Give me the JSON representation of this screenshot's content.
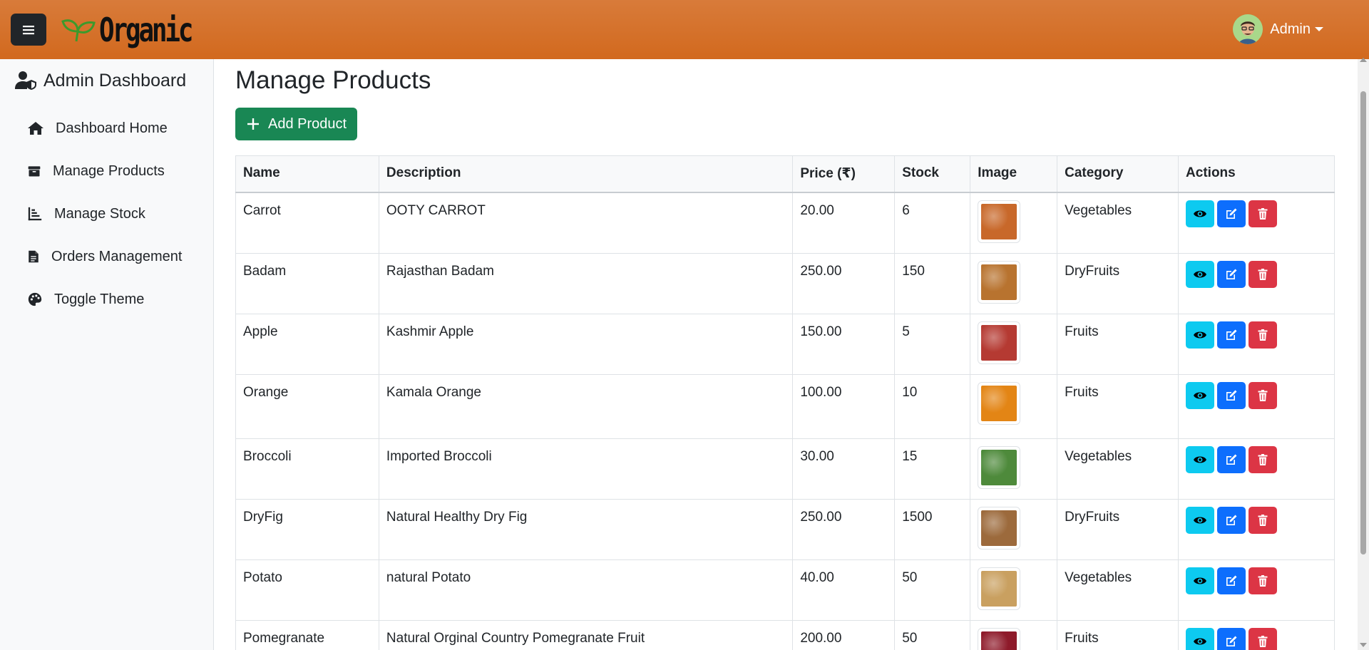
{
  "brand": {
    "name": "Organic"
  },
  "user": {
    "name": "Admin"
  },
  "sidebar": {
    "title": "Admin Dashboard",
    "items": [
      {
        "label": "Dashboard Home",
        "icon": "home-icon"
      },
      {
        "label": "Manage Products",
        "icon": "box-icon"
      },
      {
        "label": "Manage Stock",
        "icon": "bar-chart-icon"
      },
      {
        "label": "Orders Management",
        "icon": "document-icon"
      },
      {
        "label": "Toggle Theme",
        "icon": "palette-icon"
      }
    ]
  },
  "main": {
    "title": "Manage Products",
    "add_button": "Add Product"
  },
  "table": {
    "headers": [
      "Name",
      "Description",
      "Price (₹)",
      "Stock",
      "Image",
      "Category",
      "Actions"
    ],
    "rows": [
      {
        "name": "Carrot",
        "description": "OOTY CARROT",
        "price": "20.00",
        "stock": "6",
        "category": "Vegetables",
        "image": "carrot-image",
        "color": "#c8682a"
      },
      {
        "name": "Badam",
        "description": "Rajasthan Badam",
        "price": "250.00",
        "stock": "150",
        "category": "DryFruits",
        "image": "almond-image",
        "color": "#b8732f"
      },
      {
        "name": "Apple",
        "description": "Kashmir Apple",
        "price": "150.00",
        "stock": "5",
        "category": "Fruits",
        "image": "apple-image",
        "color": "#b53a32"
      },
      {
        "name": "Orange",
        "description": "Kamala Orange",
        "price": "100.00",
        "stock": "10",
        "category": "Fruits",
        "image": "orange-image",
        "color": "#e38515"
      },
      {
        "name": "Broccoli",
        "description": "Imported Broccoli",
        "price": "30.00",
        "stock": "15",
        "category": "Vegetables",
        "image": "broccoli-image",
        "color": "#4e8a3b"
      },
      {
        "name": "DryFig",
        "description": "Natural Healthy Dry Fig",
        "price": "250.00",
        "stock": "1500",
        "category": "DryFruits",
        "image": "fig-image",
        "color": "#9c6a3c"
      },
      {
        "name": "Potato",
        "description": "natural Potato",
        "price": "40.00",
        "stock": "50",
        "category": "Vegetables",
        "image": "potato-image",
        "color": "#c9a060"
      },
      {
        "name": "Pomegranate",
        "description": "Natural Orginal Country Pomegranate Fruit",
        "price": "200.00",
        "stock": "50",
        "category": "Fruits",
        "image": "pomegranate-image",
        "color": "#8e1a2a"
      }
    ]
  },
  "colors": {
    "header": "#d2691e",
    "view": "#0dcaf0",
    "edit": "#0d6efd",
    "delete": "#dc3545",
    "add": "#198754"
  }
}
